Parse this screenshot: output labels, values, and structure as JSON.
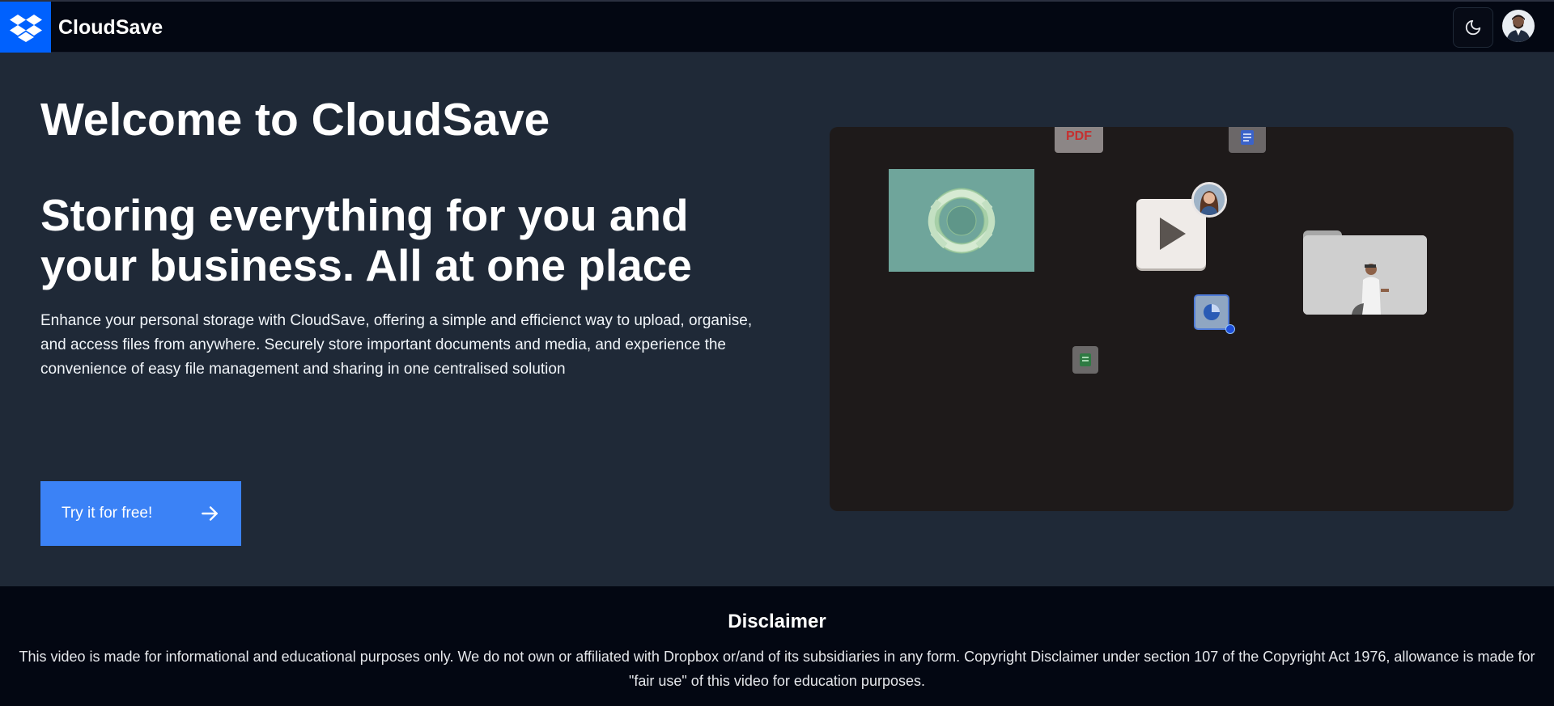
{
  "header": {
    "brand": "CloudSave",
    "logo_icon": "dropbox-logo-icon",
    "theme_toggle_icon": "moon-icon",
    "avatar_icon": "user-avatar"
  },
  "hero": {
    "title": "Welcome to CloudSave",
    "subtitle": "Storing everything for you and your business. All at one place",
    "description": "Enhance your personal storage with CloudSave, offering a simple and efficienct way to upload, organise, and access files from anywhere. Securely store important documents and media, and experience the convenience of easy file management and sharing in one centralised solution",
    "cta_label": "Try it for free!",
    "cta_icon": "arrow-right-icon"
  },
  "media": {
    "pdf_label": "PDF"
  },
  "footer": {
    "title": "Disclaimer",
    "text": "This video is made for informational and educational purposes only. We do not own or affiliated with Dropbox or/and of its subsidiaries in any form. Copyright Disclaimer under section 107 of the Copyright Act 1976, allowance is made for \"fair use\" of this video for education purposes."
  },
  "colors": {
    "header_bg": "#030712",
    "page_bg": "#1f2937",
    "accent": "#3b82f6",
    "logo_bg": "#0061fe"
  }
}
